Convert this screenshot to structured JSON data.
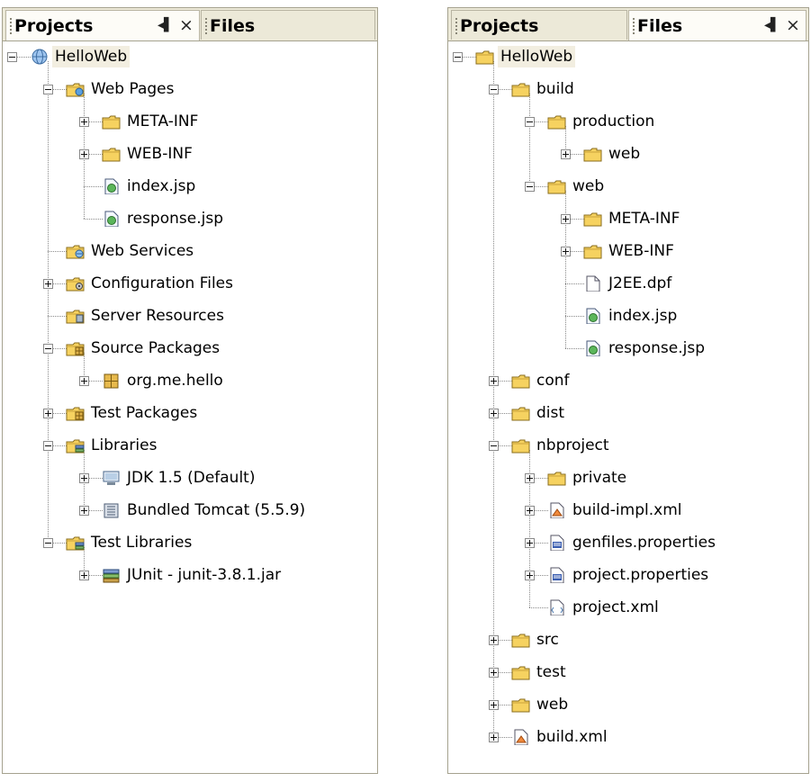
{
  "left_panel": {
    "tabs": [
      {
        "label": "Projects",
        "active": true
      },
      {
        "label": "Files",
        "active": false
      }
    ],
    "minimize_glyph": "◂▌",
    "close_glyph": "×",
    "tree": [
      {
        "label": "HelloWeb",
        "depth": 0,
        "icon": "web-project-icon",
        "exp": "minus",
        "sel": true
      },
      {
        "label": "Web Pages",
        "depth": 1,
        "icon": "web-pages-folder-icon",
        "exp": "minus"
      },
      {
        "label": "META-INF",
        "depth": 2,
        "icon": "folder-icon",
        "exp": "plus"
      },
      {
        "label": "WEB-INF",
        "depth": 2,
        "icon": "folder-icon",
        "exp": "plus"
      },
      {
        "label": "index.jsp",
        "depth": 2,
        "icon": "jsp-file-icon",
        "exp": null
      },
      {
        "label": "response.jsp",
        "depth": 2,
        "icon": "jsp-file-icon",
        "exp": null
      },
      {
        "label": "Web Services",
        "depth": 1,
        "icon": "web-services-folder-icon",
        "exp": null
      },
      {
        "label": "Configuration Files",
        "depth": 1,
        "icon": "config-folder-icon",
        "exp": "plus"
      },
      {
        "label": "Server Resources",
        "depth": 1,
        "icon": "server-resources-folder-icon",
        "exp": null
      },
      {
        "label": "Source Packages",
        "depth": 1,
        "icon": "source-packages-folder-icon",
        "exp": "minus"
      },
      {
        "label": "org.me.hello",
        "depth": 2,
        "icon": "package-icon",
        "exp": "plus"
      },
      {
        "label": "Test Packages",
        "depth": 1,
        "icon": "source-packages-folder-icon",
        "exp": "plus"
      },
      {
        "label": "Libraries",
        "depth": 1,
        "icon": "libraries-folder-icon",
        "exp": "minus"
      },
      {
        "label": "JDK 1.5 (Default)",
        "depth": 2,
        "icon": "jdk-icon",
        "exp": "plus"
      },
      {
        "label": "Bundled Tomcat (5.5.9)",
        "depth": 2,
        "icon": "server-library-icon",
        "exp": "plus"
      },
      {
        "label": "Test Libraries",
        "depth": 1,
        "icon": "libraries-folder-icon",
        "exp": "minus"
      },
      {
        "label": "JUnit - junit-3.8.1.jar",
        "depth": 2,
        "icon": "jar-library-icon",
        "exp": "plus"
      }
    ]
  },
  "right_panel": {
    "tabs": [
      {
        "label": "Projects",
        "active": false
      },
      {
        "label": "Files",
        "active": true
      }
    ],
    "minimize_glyph": "◂▌",
    "close_glyph": "×",
    "tree": [
      {
        "label": "HelloWeb",
        "depth": 0,
        "icon": "folder-icon",
        "exp": "minus",
        "sel": true
      },
      {
        "label": "build",
        "depth": 1,
        "icon": "folder-icon",
        "exp": "minus"
      },
      {
        "label": "production",
        "depth": 2,
        "icon": "folder-icon",
        "exp": "minus"
      },
      {
        "label": "web",
        "depth": 3,
        "icon": "folder-icon",
        "exp": "plus"
      },
      {
        "label": "web",
        "depth": 2,
        "icon": "folder-icon",
        "exp": "minus"
      },
      {
        "label": "META-INF",
        "depth": 3,
        "icon": "folder-icon",
        "exp": "plus"
      },
      {
        "label": "WEB-INF",
        "depth": 3,
        "icon": "folder-icon",
        "exp": "plus"
      },
      {
        "label": "J2EE.dpf",
        "depth": 3,
        "icon": "file-icon",
        "exp": null
      },
      {
        "label": "index.jsp",
        "depth": 3,
        "icon": "jsp-file-icon",
        "exp": null
      },
      {
        "label": "response.jsp",
        "depth": 3,
        "icon": "jsp-file-icon",
        "exp": null
      },
      {
        "label": "conf",
        "depth": 1,
        "icon": "folder-icon",
        "exp": "plus"
      },
      {
        "label": "dist",
        "depth": 1,
        "icon": "folder-icon",
        "exp": "plus"
      },
      {
        "label": "nbproject",
        "depth": 1,
        "icon": "folder-icon",
        "exp": "minus"
      },
      {
        "label": "private",
        "depth": 2,
        "icon": "folder-icon",
        "exp": "plus"
      },
      {
        "label": "build-impl.xml",
        "depth": 2,
        "icon": "ant-xml-icon",
        "exp": "plus"
      },
      {
        "label": "genfiles.properties",
        "depth": 2,
        "icon": "properties-file-icon",
        "exp": "plus"
      },
      {
        "label": "project.properties",
        "depth": 2,
        "icon": "properties-file-icon",
        "exp": "plus"
      },
      {
        "label": "project.xml",
        "depth": 2,
        "icon": "xml-file-icon",
        "exp": null
      },
      {
        "label": "src",
        "depth": 1,
        "icon": "folder-icon",
        "exp": "plus"
      },
      {
        "label": "test",
        "depth": 1,
        "icon": "folder-icon",
        "exp": "plus"
      },
      {
        "label": "web",
        "depth": 1,
        "icon": "folder-icon",
        "exp": "plus"
      },
      {
        "label": "build.xml",
        "depth": 1,
        "icon": "ant-xml-icon",
        "exp": "plus"
      }
    ]
  },
  "colors": {
    "tab_bg": "#ece9d8",
    "active_tab_bg": "#fdfcf7",
    "selection_bg": "#f2eee0",
    "folder": "#f3c94b",
    "border": "#a5a28f"
  }
}
